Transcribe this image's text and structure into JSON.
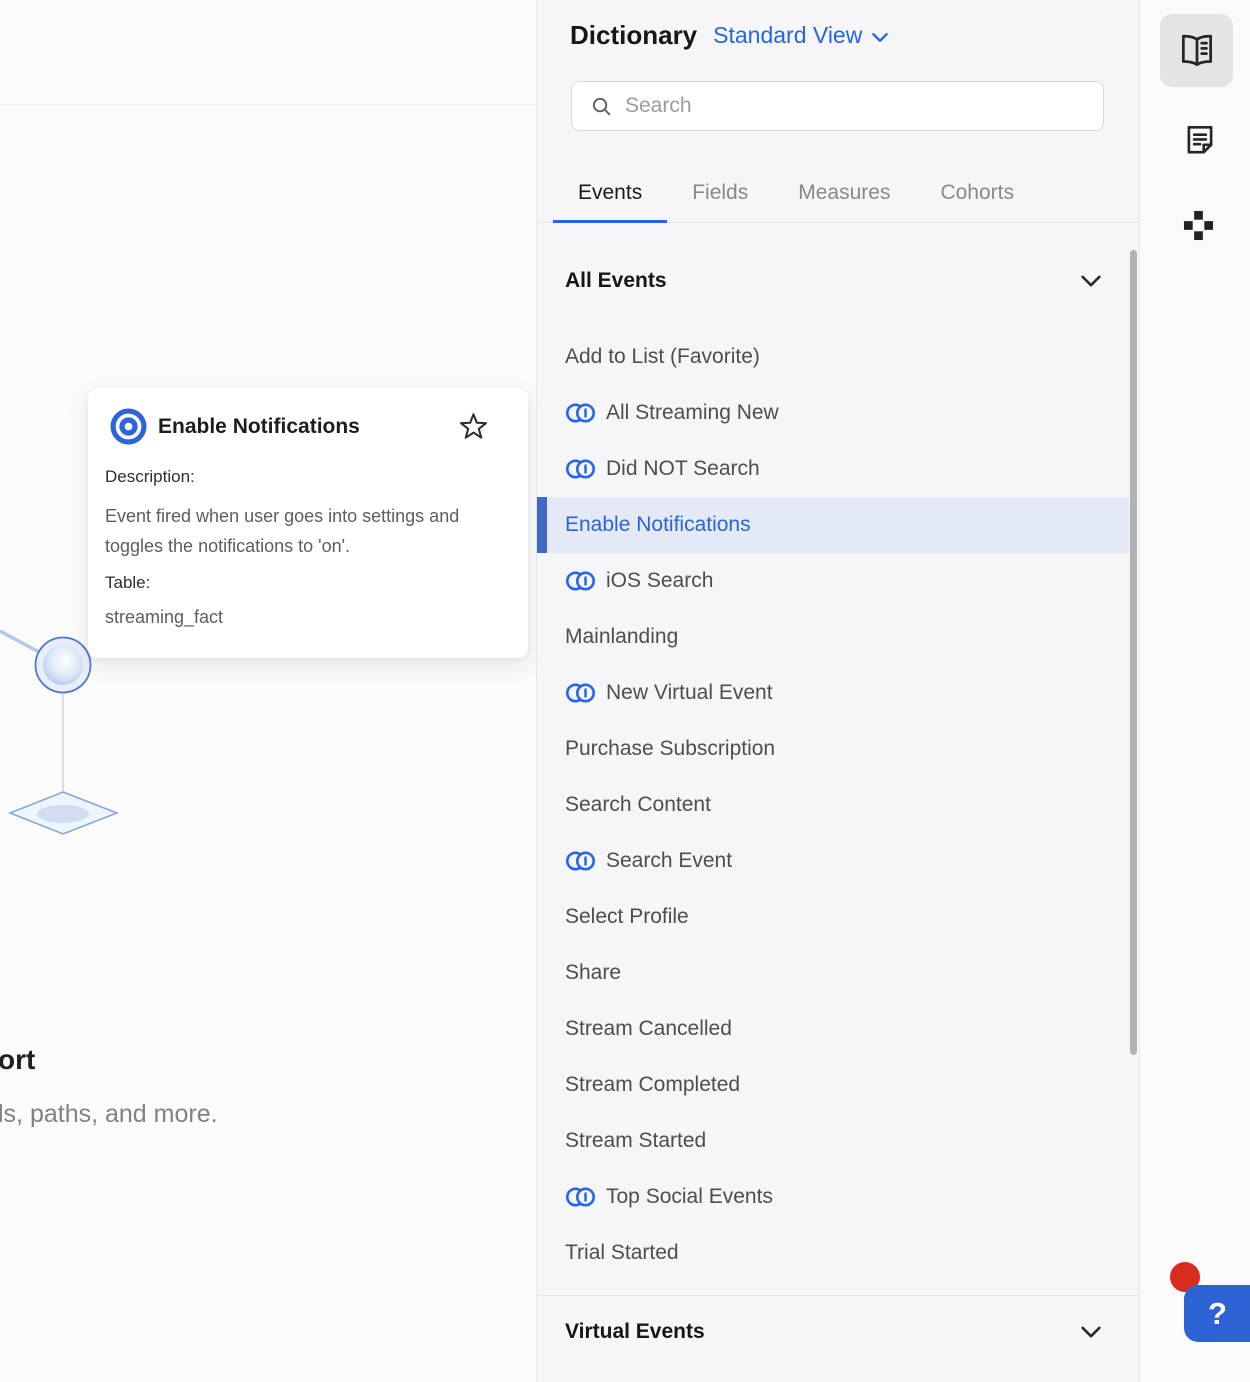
{
  "left_panel": {
    "heading_fragment": "ort",
    "subtitle_fragment": "ls, paths, and more."
  },
  "event_card": {
    "title": "Enable Notifications",
    "description_label": "Description:",
    "description_text": "Event fired when user goes into settings and toggles the notifications to 'on'.",
    "table_label": "Table:",
    "table_name": "streaming_fact"
  },
  "dictionary": {
    "title": "Dictionary",
    "view_selector_label": "Standard View",
    "search_placeholder": "Search",
    "tabs": [
      {
        "label": "Events",
        "active": true
      },
      {
        "label": "Fields",
        "active": false
      },
      {
        "label": "Measures",
        "active": false
      },
      {
        "label": "Cohorts",
        "active": false
      }
    ],
    "all_events_section_label": "All Events",
    "virtual_events_section_label": "Virtual Events",
    "events": [
      {
        "label": "Add to List (Favorite)",
        "virtual": false,
        "selected": false
      },
      {
        "label": "All Streaming New",
        "virtual": true,
        "selected": false
      },
      {
        "label": "Did NOT Search",
        "virtual": true,
        "selected": false
      },
      {
        "label": "Enable Notifications",
        "virtual": false,
        "selected": true
      },
      {
        "label": "iOS Search",
        "virtual": true,
        "selected": false
      },
      {
        "label": "Mainlanding",
        "virtual": false,
        "selected": false
      },
      {
        "label": "New Virtual Event",
        "virtual": true,
        "selected": false
      },
      {
        "label": "Purchase Subscription",
        "virtual": false,
        "selected": false
      },
      {
        "label": "Search Content",
        "virtual": false,
        "selected": false
      },
      {
        "label": "Search Event",
        "virtual": true,
        "selected": false
      },
      {
        "label": "Select Profile",
        "virtual": false,
        "selected": false
      },
      {
        "label": "Share",
        "virtual": false,
        "selected": false
      },
      {
        "label": "Stream Cancelled",
        "virtual": false,
        "selected": false
      },
      {
        "label": "Stream Completed",
        "virtual": false,
        "selected": false
      },
      {
        "label": "Stream Started",
        "virtual": false,
        "selected": false
      },
      {
        "label": "Top Social Events",
        "virtual": true,
        "selected": false
      },
      {
        "label": "Trial Started",
        "virtual": false,
        "selected": false
      }
    ]
  },
  "right_toolbar": {
    "icons": [
      "dictionary-book-icon",
      "notes-icon",
      "apps-grid-icon"
    ],
    "help_button_label": "?"
  },
  "colors": {
    "accent_blue": "#2563eb",
    "selected_row_bg": "#e4eaf5",
    "selected_row_bar": "#3e6ac5",
    "selected_row_text": "#2d63d9",
    "help_button_bg": "#2e63d6",
    "notification_badge_red": "#d72c1e"
  }
}
